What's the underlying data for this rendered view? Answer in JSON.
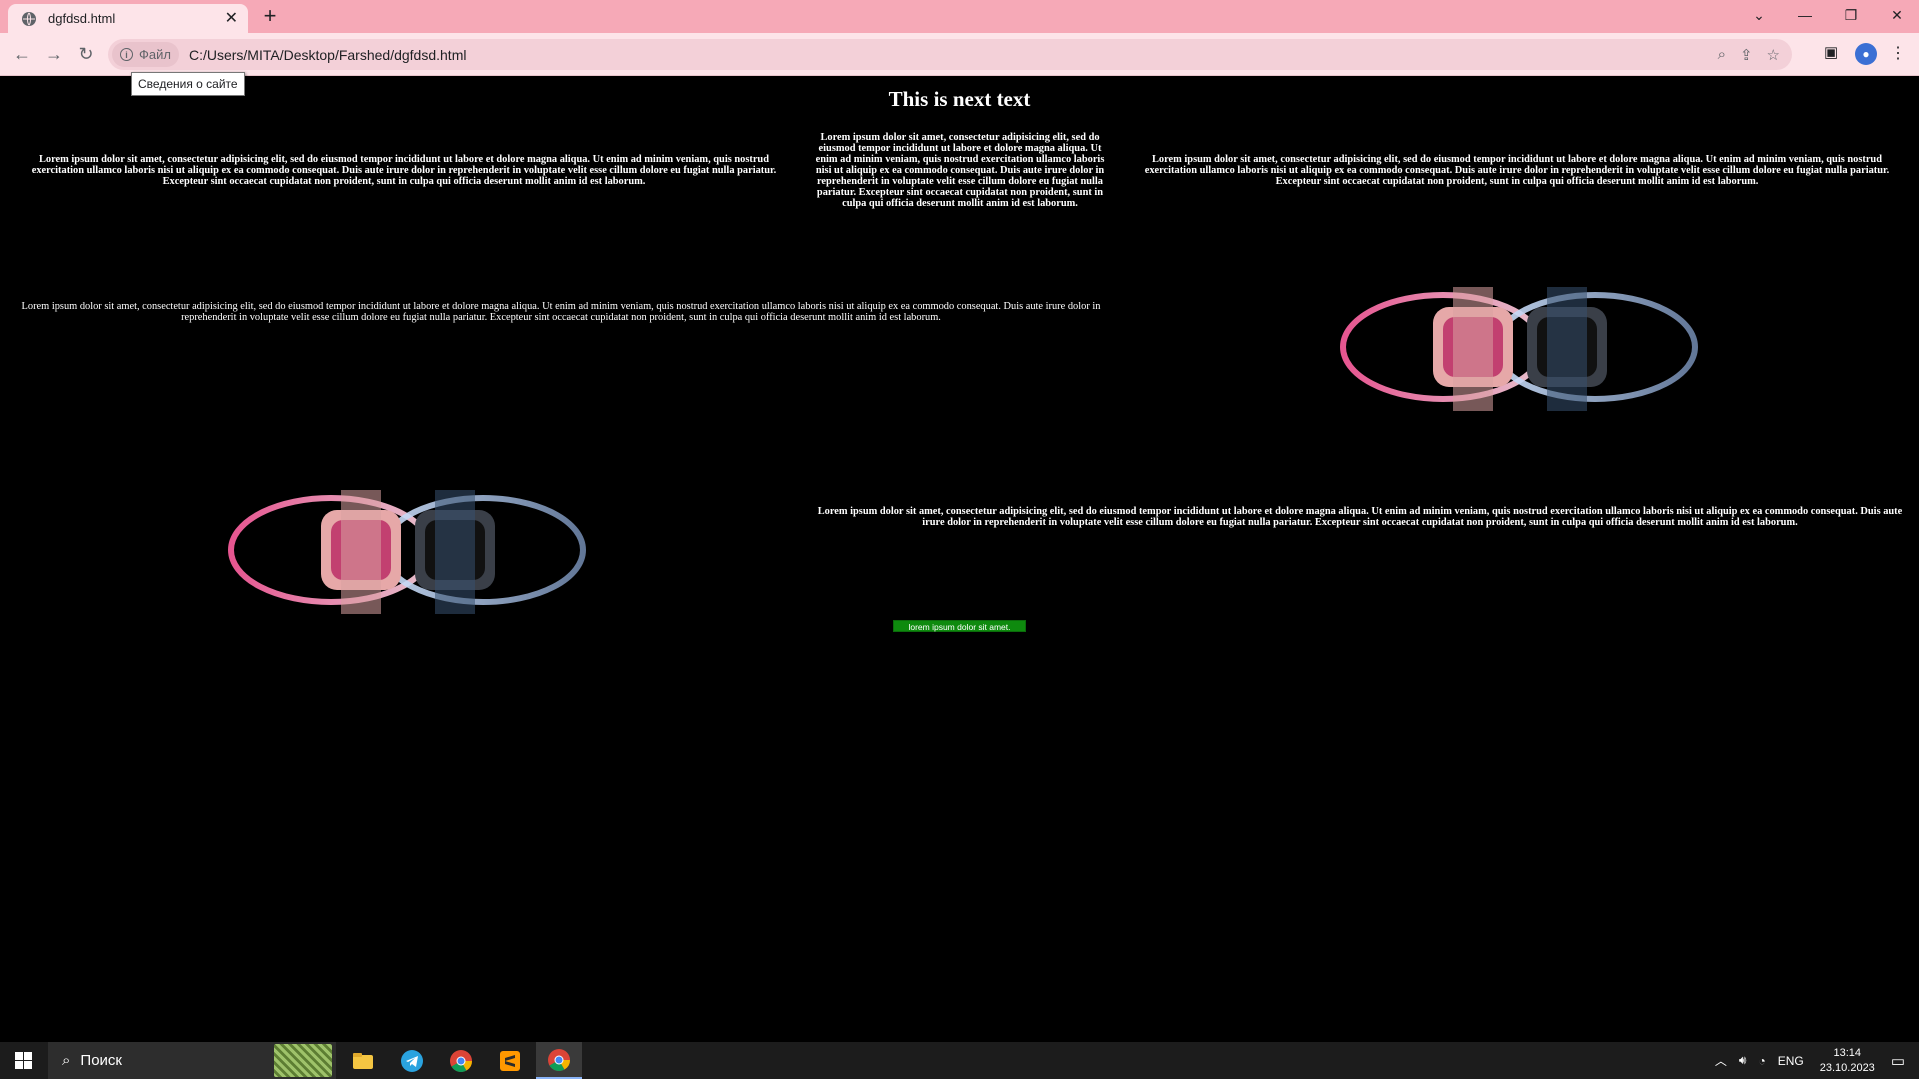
{
  "browser": {
    "tab_title": "dgfdsd.html",
    "site_chip_label": "Файл",
    "url": "C:/Users/MITA/Desktop/Farshed/dgfdsd.html",
    "tooltip": "Сведения о сайте"
  },
  "page": {
    "heading": "This is next text",
    "lorem": "Lorem ipsum dolor sit amet, consectetur adipisicing elit, sed do eiusmod tempor incididunt ut labore et dolore magna aliqua. Ut enim ad minim veniam, quis nostrud exercitation ullamco laboris nisi ut aliquip ex ea commodo consequat. Duis aute irure dolor in reprehenderit in voluptate velit esse cillum dolore eu fugiat nulla pariatur. Excepteur sint occaecat cupidatat non proident, sunt in culpa qui officia deserunt mollit anim id est laborum.",
    "button_label": "lorem ipsum dolor sit amet.",
    "button_color": "#0e8a0e"
  },
  "taskbar": {
    "search_placeholder": "Поиск",
    "language": "ENG",
    "time": "13:14",
    "date": "23.10.2023",
    "apps": [
      "file-explorer-icon",
      "telegram-icon",
      "chrome-icon",
      "sublime-text-icon",
      "chrome-icon"
    ]
  },
  "colors": {
    "tab_strip": "#f6a9b7",
    "toolbar": "#fde4e9",
    "page_background": "#000000",
    "taskbar": "#1c1c1c"
  }
}
